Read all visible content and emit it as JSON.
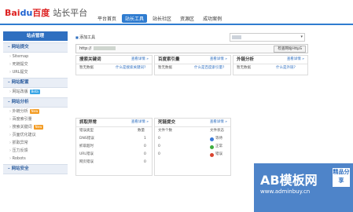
{
  "header": {
    "logo_baidu": "Bai",
    "logo_paw": "du",
    "logo_cn": "百度",
    "logo_site": "站长平台",
    "nav": [
      "平台首页",
      "站长工具",
      "站长社区",
      "资源区",
      "成功案例"
    ],
    "active_index": 1
  },
  "sidebar": {
    "section_title": "站点管理",
    "groups": [
      {
        "title": "网站提交",
        "items": [
          {
            "label": "Sitemap"
          },
          {
            "label": "死链提交"
          },
          {
            "label": "URL提交"
          }
        ]
      },
      {
        "title": "网站配置",
        "items": [
          {
            "label": "网站改版",
            "badge": "Beta",
            "badge_color": "#3aa6e6"
          }
        ]
      },
      {
        "title": "网站分析",
        "items": [
          {
            "label": "外链分析",
            "badge": "New",
            "badge_color": "#f39c24"
          },
          {
            "label": "百度索引量"
          },
          {
            "label": "搜索关键词",
            "badge": "New",
            "badge_color": "#f39c24"
          },
          {
            "label": "页面优化建议"
          },
          {
            "label": "抓取异常"
          },
          {
            "label": "压力反馈"
          },
          {
            "label": "Robots"
          }
        ]
      },
      {
        "title": "网站安全",
        "items": []
      }
    ]
  },
  "main": {
    "add_tools": "添加工具",
    "http_label": "http://",
    "check_button": "检查网站HttpS",
    "panels": {
      "keywords": {
        "title": "搜索关键词",
        "more": "查看详情 »",
        "col1": "暂无数据",
        "col2": "什么是搜索关键词?"
      },
      "index": {
        "title": "百度索引量",
        "more": "查看详情 »",
        "col1": "暂无数据",
        "col2": "什么是百度索引量?"
      },
      "links": {
        "title": "外链分析",
        "more": "查看详情 »",
        "col1": "暂无数据",
        "col2": "什么是外链?"
      },
      "crawl": {
        "title": "抓取异常",
        "more": "查看详情 »",
        "header": [
          "错误类型",
          "数量"
        ],
        "rows": [
          [
            "DNS错误",
            "1"
          ],
          [
            "抓取超时",
            "0"
          ],
          [
            "URL错误",
            "0"
          ],
          [
            "网页错误",
            "0"
          ]
        ]
      },
      "submit": {
        "title": "死链提交",
        "more": "查看详情 »",
        "header": [
          "文件个数",
          "文件状态"
        ],
        "rows": [
          {
            "count": "0",
            "status": "等待",
            "color": "#3a7ad8"
          },
          {
            "count": "0",
            "status": "正常",
            "color": "#3fae3f"
          },
          {
            "count": "0",
            "status": "错误",
            "color": "#d9442f"
          }
        ]
      }
    }
  },
  "watermark": {
    "title": "AB模板网",
    "url": "www.adminbuy.cn",
    "box": "精品分享"
  }
}
